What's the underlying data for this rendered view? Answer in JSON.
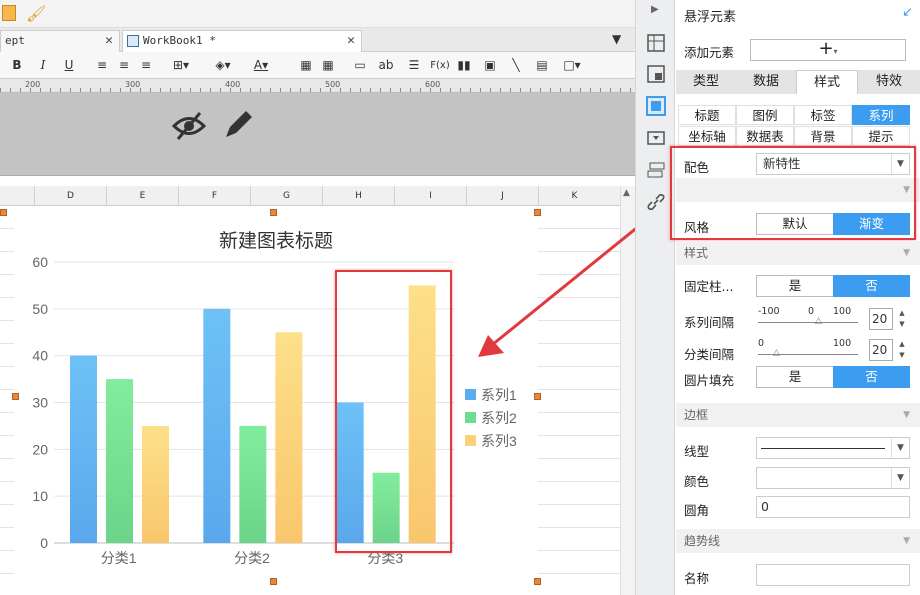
{
  "tabs": [
    {
      "label": "ept"
    },
    {
      "label": "WorkBook1 *"
    }
  ],
  "toolbar": {
    "bold": "B",
    "italic": "I",
    "underline": "U",
    "font_color_label": "A",
    "text_ab": "ab",
    "formula_fx": "F(x)"
  },
  "ruler": {
    "ticks": [
      "200",
      "300",
      "400",
      "500",
      "600"
    ]
  },
  "columns": [
    "D",
    "E",
    "F",
    "G",
    "H",
    "I",
    "J",
    "K"
  ],
  "chart_data": {
    "type": "bar",
    "title": "新建图表标题",
    "categories": [
      "分类1",
      "分类2",
      "分类3"
    ],
    "series": [
      {
        "name": "系列1",
        "values": [
          40,
          50,
          30
        ],
        "color": "#5aaef0"
      },
      {
        "name": "系列2",
        "values": [
          35,
          25,
          15
        ],
        "color": "#6fdc90"
      },
      {
        "name": "系列3",
        "values": [
          25,
          45,
          55
        ],
        "color": "#fbd179"
      }
    ],
    "yticks": [
      "0",
      "10",
      "20",
      "30",
      "40",
      "50",
      "60"
    ],
    "ylim": [
      0,
      60
    ],
    "grid": true,
    "legend": "right"
  },
  "panel": {
    "title": "悬浮元素",
    "add_element_label": "添加元素",
    "add_element_button": "+",
    "main_tabs": [
      {
        "label": "类型"
      },
      {
        "label": "数据"
      },
      {
        "label": "样式"
      },
      {
        "label": "特效"
      }
    ],
    "sub_tabs": [
      {
        "label": "标题"
      },
      {
        "label": "图例"
      },
      {
        "label": "标签"
      },
      {
        "label": "系列"
      },
      {
        "label": "坐标轴"
      },
      {
        "label": "数据表"
      },
      {
        "label": "背景"
      },
      {
        "label": "提示"
      }
    ],
    "color_label": "配色",
    "color_value": "新特性",
    "style_label": "风格",
    "style_default": "默认",
    "style_gradient": "渐变",
    "section_style": "样式",
    "fixed_col_label": "固定柱...",
    "yes": "是",
    "no": "否",
    "series_gap_label": "系列间隔",
    "series_gap_min": "-100",
    "series_gap_mid": "0",
    "series_gap_max": "100",
    "series_gap_value": "20",
    "cat_gap_label": "分类间隔",
    "cat_gap_min": "0",
    "cat_gap_max": "100",
    "cat_gap_value": "20",
    "image_fill_label": "圆片填充",
    "section_border": "边框",
    "line_type_label": "线型",
    "border_color_label": "颜色",
    "radius_label": "圆角",
    "radius_value": "0",
    "section_trend": "趋势线",
    "name_label": "名称"
  }
}
